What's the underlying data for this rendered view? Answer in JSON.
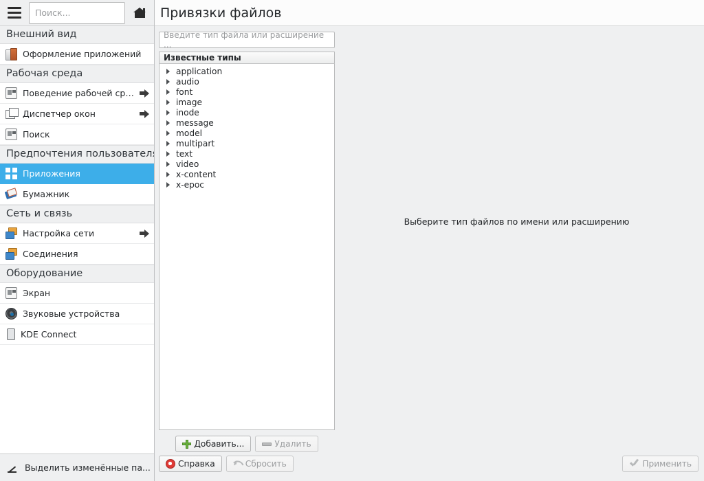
{
  "sidebar": {
    "search": {
      "placeholder": "Поиск..."
    },
    "toolbar": {
      "menu_icon": "hamburger-menu-icon",
      "home_icon": "home-icon"
    },
    "groups": [
      {
        "header": "Внешний вид",
        "items": [
          {
            "label": "Оформление приложений",
            "icon": "theme-icon",
            "arrow": false,
            "selected": false
          }
        ]
      },
      {
        "header": "Рабочая среда",
        "items": [
          {
            "label": "Поведение рабочей среды",
            "icon": "monitor-icon",
            "arrow": true,
            "selected": false
          },
          {
            "label": "Диспетчер окон",
            "icon": "windows-icon",
            "arrow": true,
            "selected": false
          },
          {
            "label": "Поиск",
            "icon": "monitor-icon",
            "arrow": false,
            "selected": false
          }
        ]
      },
      {
        "header": "Предпочтения пользователя",
        "items": [
          {
            "label": "Приложения",
            "icon": "grid-icon",
            "arrow": false,
            "selected": true
          },
          {
            "label": "Бумажник",
            "icon": "wallet-icon",
            "arrow": false,
            "selected": false
          }
        ]
      },
      {
        "header": "Сеть и связь",
        "items": [
          {
            "label": "Настройка сети",
            "icon": "network-icon",
            "arrow": true,
            "selected": false
          },
          {
            "label": "Соединения",
            "icon": "network-icon",
            "arrow": false,
            "selected": false
          }
        ]
      },
      {
        "header": "Оборудование",
        "items": [
          {
            "label": "Экран",
            "icon": "monitor-icon",
            "arrow": false,
            "selected": false
          },
          {
            "label": "Звуковые устройства",
            "icon": "audio-icon",
            "arrow": false,
            "selected": false
          },
          {
            "label": "KDE Connect",
            "icon": "phone-icon",
            "arrow": false,
            "selected": false
          }
        ]
      }
    ],
    "footer": {
      "label": "Выделить изменённые па...",
      "icon": "pencil-icon"
    }
  },
  "main": {
    "title": "Привязки файлов",
    "filter": {
      "placeholder": "Введите тип файла или расширение ..."
    },
    "list_header": "Известные типы",
    "tree_items": [
      "application",
      "audio",
      "font",
      "image",
      "inode",
      "message",
      "model",
      "multipart",
      "text",
      "video",
      "x-content",
      "x-epoc"
    ],
    "empty_hint": "Выберите тип файлов по имени или расширению",
    "list_buttons": [
      {
        "label": "Добавить...",
        "icon": "plus-icon",
        "disabled": false
      },
      {
        "label": "Удалить",
        "icon": "minus-icon",
        "disabled": true
      }
    ],
    "bottom_buttons": [
      {
        "label": "Справка",
        "icon": "help-icon",
        "disabled": false
      },
      {
        "label": "Сбросить",
        "icon": "reset-icon",
        "disabled": true
      },
      {
        "label": "Применить",
        "icon": "check-icon",
        "disabled": true
      }
    ]
  },
  "colors": {
    "selection": "#3daee9",
    "window_bg": "#eff0f1",
    "panel_bg": "#ffffff",
    "text": "#232629",
    "disabled_text": "#9b9d9f"
  }
}
